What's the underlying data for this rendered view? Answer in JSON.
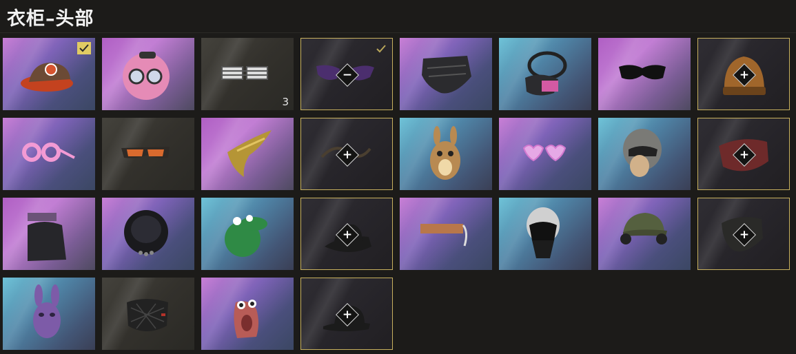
{
  "header": {
    "title": "衣柜–头部"
  },
  "theme": {
    "accent": "#c9b25f",
    "check": "#e1cb63",
    "background": "#1c1b19"
  },
  "items": [
    {
      "icon": "cap-icon",
      "bg": "purple",
      "equipped": true
    },
    {
      "icon": "pink-donut-mask-icon",
      "bg": "pink"
    },
    {
      "icon": "shutter-shades-icon",
      "bg": "dark",
      "count": "3"
    },
    {
      "icon": "purple-glasses-icon",
      "bg": "owned",
      "equipped": true,
      "action": "−"
    },
    {
      "icon": "black-face-mask-icon",
      "bg": "purple"
    },
    {
      "icon": "gas-mask-goggles-icon",
      "bg": "blue"
    },
    {
      "icon": "black-sunglasses-icon",
      "bg": "pink"
    },
    {
      "icon": "knit-beanie-icon",
      "bg": "owned",
      "action": "+"
    },
    {
      "icon": "pink-round-glasses-icon",
      "bg": "purple"
    },
    {
      "icon": "sport-sunglasses-icon",
      "bg": "dark"
    },
    {
      "icon": "golden-wing-mask-icon",
      "bg": "pink"
    },
    {
      "icon": "ornament-mask-icon",
      "bg": "owned",
      "action": "+"
    },
    {
      "icon": "squirrel-mask-icon",
      "bg": "blue"
    },
    {
      "icon": "heart-glasses-icon",
      "bg": "purple"
    },
    {
      "icon": "pilot-helmet-mask-icon",
      "bg": "blue"
    },
    {
      "icon": "red-cloth-mask-icon",
      "bg": "owned",
      "action": "+"
    },
    {
      "icon": "balaclava-visor-icon",
      "bg": "pink"
    },
    {
      "icon": "space-helmet-icon",
      "bg": "purple"
    },
    {
      "icon": "green-dino-mask-icon",
      "bg": "blue"
    },
    {
      "icon": "bucket-hat-icon",
      "bg": "owned",
      "action": "+"
    },
    {
      "icon": "orange-visor-icon",
      "bg": "purple"
    },
    {
      "icon": "tactical-helmet-icon",
      "bg": "blue"
    },
    {
      "icon": "headset-cap-icon",
      "bg": "purple"
    },
    {
      "icon": "bandana-icon",
      "bg": "owned",
      "action": "+"
    },
    {
      "icon": "purple-bunny-mask-icon",
      "bg": "blue"
    },
    {
      "icon": "quilted-face-mask-icon",
      "bg": "dark"
    },
    {
      "icon": "worm-mask-icon",
      "bg": "purple"
    },
    {
      "icon": "black-cap-icon",
      "bg": "owned",
      "action": "+"
    }
  ]
}
